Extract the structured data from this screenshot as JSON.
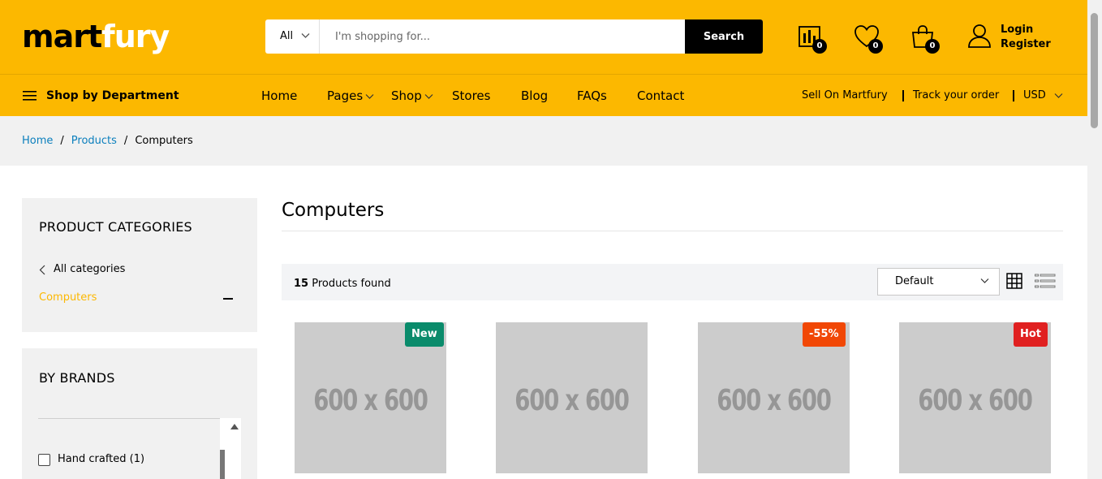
{
  "header": {
    "logo_primary": "mart",
    "logo_secondary": "fury",
    "search": {
      "category_value": "All",
      "placeholder": "I'm shopping for...",
      "button_label": "Search"
    },
    "compare_count": "0",
    "wishlist_count": "0",
    "cart_count": "0",
    "login_label": "Login",
    "register_label": "Register",
    "brand_color": "#fcb800"
  },
  "nav": {
    "department_label": "Shop by Department",
    "items": [
      "Home",
      "Pages",
      "Shop",
      "Stores",
      "Blog",
      "FAQs",
      "Contact"
    ],
    "sell_label": "Sell On Martfury",
    "track_label": "Track your order",
    "currency": "USD"
  },
  "breadcrumb": {
    "items": [
      "Home",
      "Products",
      "Computers"
    ]
  },
  "sidebar": {
    "categories_title": "PRODUCT CATEGORIES",
    "all_categories_label": "All categories",
    "current_category": "Computers",
    "brands_title": "BY BRANDS",
    "brands": [
      {
        "label": "Hand crafted (1)",
        "checked": false
      }
    ]
  },
  "main": {
    "title": "Computers",
    "found_count": "15",
    "found_label": "Products found",
    "sort_value": "Default",
    "products": [
      {
        "image_label": "600 x 600",
        "tag": "New",
        "tag_color": "#0a8b6b"
      },
      {
        "image_label": "600 x 600",
        "tag": "",
        "tag_color": ""
      },
      {
        "image_label": "600 x 600",
        "tag": "-55%",
        "tag_color": "#f14705"
      },
      {
        "image_label": "600 x 600",
        "tag": "Hot",
        "tag_color": "#e02020"
      }
    ]
  }
}
